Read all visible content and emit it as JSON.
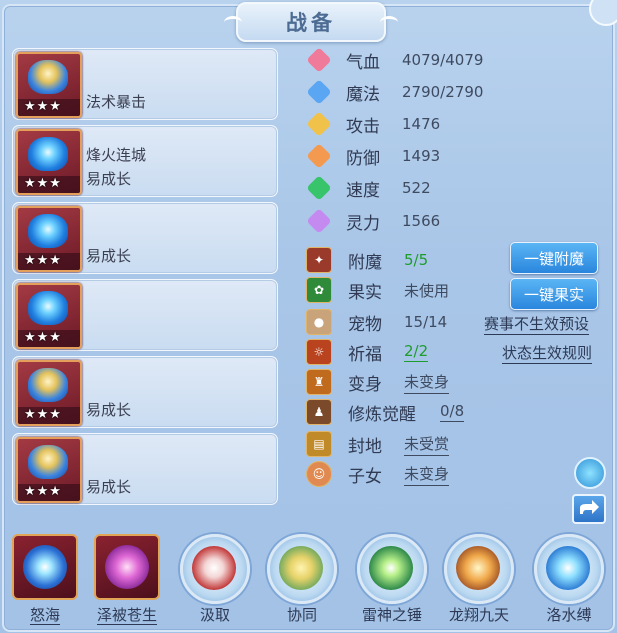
{
  "panel": {
    "title": "战备"
  },
  "cards": [
    {
      "line1": "",
      "line2": "法术暴击",
      "stars": "★★★"
    },
    {
      "line1": "烽火连城",
      "line2": "易成长",
      "stars": "★★★"
    },
    {
      "line1": "",
      "line2": "易成长",
      "stars": "★★★"
    },
    {
      "line1": "",
      "line2": "",
      "stars": "★★★"
    },
    {
      "line1": "",
      "line2": "易成长",
      "stars": "★★★"
    },
    {
      "line1": "",
      "line2": "易成长",
      "stars": "★★★"
    }
  ],
  "stats": [
    {
      "label": "气血",
      "value": "4079/4079",
      "icon": "heart-icon",
      "color": "#f07a9a"
    },
    {
      "label": "魔法",
      "value": "2790/2790",
      "icon": "mana-icon",
      "color": "#5aa6f2"
    },
    {
      "label": "攻击",
      "value": "1476",
      "icon": "sword-icon",
      "color": "#f1c24a"
    },
    {
      "label": "防御",
      "value": "1493",
      "icon": "shield-icon",
      "color": "#f39a50"
    },
    {
      "label": "速度",
      "value": "522",
      "icon": "lightning-icon",
      "color": "#38c46a"
    },
    {
      "label": "灵力",
      "value": "1566",
      "icon": "spirit-icon",
      "color": "#c48af0"
    }
  ],
  "attrs": [
    {
      "label": "附魔",
      "value": "5/5"
    },
    {
      "label": "果实",
      "value": "未使用"
    },
    {
      "label": "宠物",
      "value": "15/14"
    },
    {
      "label": "祈福",
      "value": "2/2"
    },
    {
      "label": "变身",
      "value": "未变身"
    },
    {
      "label": "修炼觉醒",
      "value": "0/8"
    },
    {
      "label": "封地",
      "value": "未受赏"
    },
    {
      "label": "子女",
      "value": "未变身"
    }
  ],
  "buttons": {
    "enchant": "一键附魔",
    "fruit": "一键果实"
  },
  "links": {
    "event_preset": "赛事不生效预设",
    "status_rules": "状态生效规则"
  },
  "skills": [
    {
      "label": "怒海",
      "underline": true
    },
    {
      "label": "泽被苍生",
      "underline": true
    },
    {
      "label": "汲取",
      "underline": false
    },
    {
      "label": "协同",
      "underline": false
    },
    {
      "label": "雷神之锤",
      "underline": false
    },
    {
      "label": "龙翔九天",
      "underline": false
    },
    {
      "label": "洛水缚",
      "underline": false
    }
  ],
  "colors": {
    "accent_button": "#2a86dd",
    "value_green": "#1e9c2c"
  }
}
